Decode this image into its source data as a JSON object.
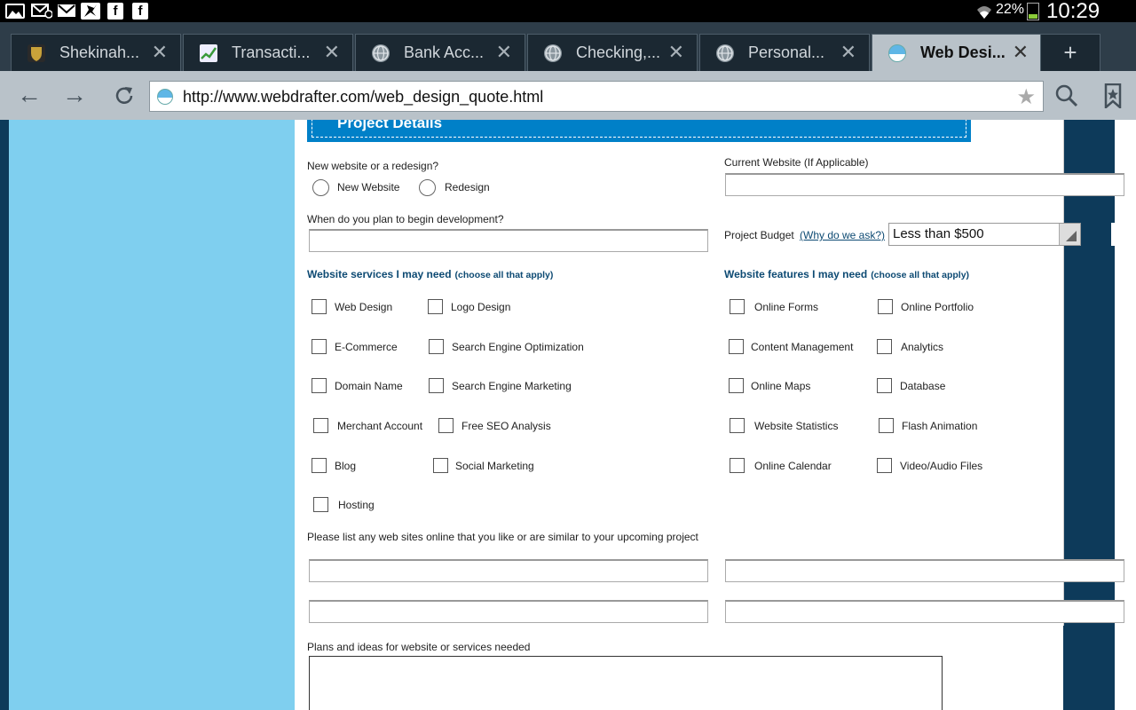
{
  "status_bar": {
    "battery_pct": "22%",
    "time": "10:29 PM"
  },
  "tabs": [
    {
      "title": "Shekinah...",
      "favicon_color": "#c8a23a",
      "active": false
    },
    {
      "title": "Transacti...",
      "favicon_color": "#e8f0e0",
      "active": false
    },
    {
      "title": "Bank Acc...",
      "favicon_color": "#8a969e",
      "active": false
    },
    {
      "title": "Checking,...",
      "favicon_color": "#8a969e",
      "active": false
    },
    {
      "title": "Personal...",
      "favicon_color": "#8a969e",
      "active": false
    },
    {
      "title": "Web Desi...",
      "favicon_color": "#5fb6e6",
      "active": true
    }
  ],
  "new_tab_label": "+",
  "address_bar": {
    "url": "http://www.webdrafter.com/web_design_quote.html"
  },
  "form": {
    "section_title": "Project Details",
    "new_or_redesign_label": "New website or a redesign?",
    "radio_new": "New Website",
    "radio_redesign": "Redesign",
    "current_website_label": "Current Website  (If Applicable)",
    "begin_dev_label": "When do you plan to begin development?",
    "budget_label": "Project Budget",
    "budget_why": "(Why do we ask?)",
    "budget_value": "Less than $500",
    "services_heading": "Website services I may need",
    "features_heading": "Website features I may need",
    "choose_all": "(choose all that apply)",
    "services": [
      "Web Design",
      "Logo Design",
      "E-Commerce",
      "Search Engine Optimization",
      "Domain Name",
      "Search Engine Marketing",
      "Merchant Account",
      "Free SEO Analysis",
      "Blog",
      "Social Marketing",
      "Hosting"
    ],
    "features": [
      "Online Forms",
      "Online Portfolio",
      "Content Management",
      "Analytics",
      "Online Maps",
      "Database",
      "Website Statistics",
      "Flash Animation",
      "Online Calendar",
      "Video/Audio Files"
    ],
    "similar_sites_label": "Please list any web sites online that you like or are similar to your upcoming project",
    "plans_label": "Plans and ideas for website or services needed"
  },
  "colors": {
    "left_panel": "#7fcfef",
    "header_blue": "#0080c8",
    "heading_text": "#0d4a73",
    "dark_side": "#0d3a5a"
  }
}
